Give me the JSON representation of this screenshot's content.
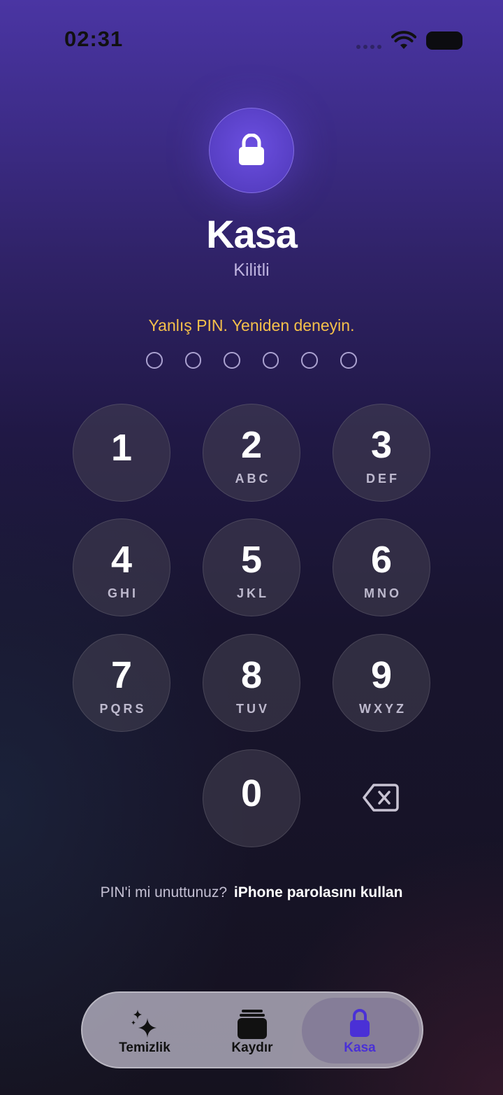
{
  "status_bar": {
    "time": "02:31",
    "wifi_icon": "wifi-icon",
    "battery_icon": "battery-icon"
  },
  "header": {
    "icon": "lock-icon",
    "title": "Kasa",
    "subtitle": "Kilitli"
  },
  "pin": {
    "error": "Yanlış PIN. Yeniden deneyin.",
    "length": 6,
    "entered": 0
  },
  "keypad": {
    "keys": [
      {
        "digit": "1",
        "letters": ""
      },
      {
        "digit": "2",
        "letters": "ABC"
      },
      {
        "digit": "3",
        "letters": "DEF"
      },
      {
        "digit": "4",
        "letters": "GHI"
      },
      {
        "digit": "5",
        "letters": "JKL"
      },
      {
        "digit": "6",
        "letters": "MNO"
      },
      {
        "digit": "7",
        "letters": "PQRS"
      },
      {
        "digit": "8",
        "letters": "TUV"
      },
      {
        "digit": "9",
        "letters": "WXYZ"
      },
      {
        "digit": "0",
        "letters": ""
      }
    ],
    "delete_icon": "backspace-icon"
  },
  "forgot": {
    "text": "PIN'i mi unuttunuz?",
    "link": "iPhone parolasını kullan"
  },
  "tab_bar": {
    "tabs": [
      {
        "label": "Temizlik",
        "icon": "sparkles-icon",
        "active": false
      },
      {
        "label": "Kaydır",
        "icon": "cards-stack-icon",
        "active": false
      },
      {
        "label": "Kasa",
        "icon": "lock-icon",
        "active": true
      }
    ],
    "active_color": "#4a30d6"
  },
  "colors": {
    "error": "#f5c04a",
    "accent": "#5b41d0"
  }
}
